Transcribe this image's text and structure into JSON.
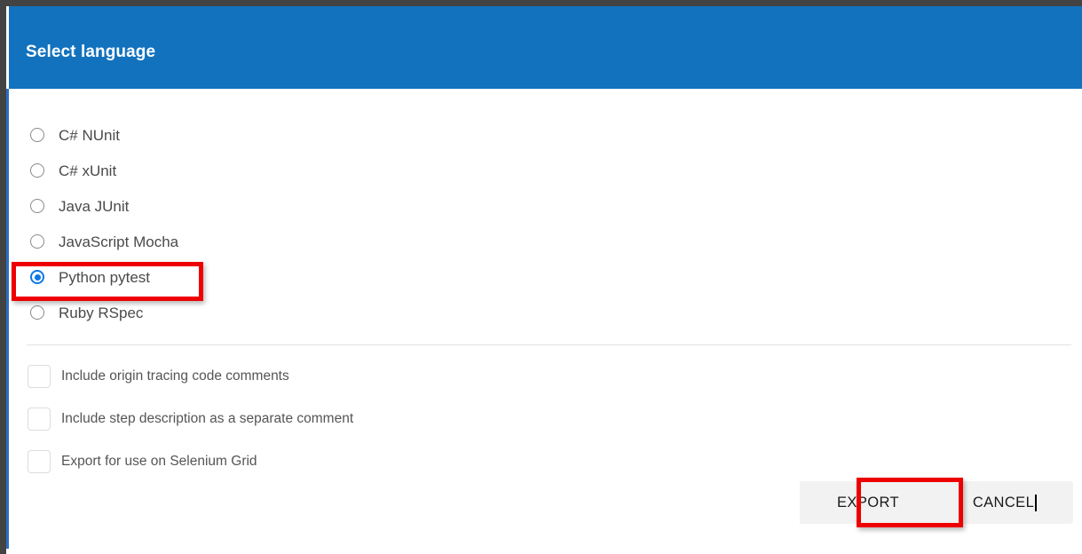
{
  "colors": {
    "header_blue": "#1272be",
    "chrome_dark": "#434343",
    "accent_blue": "#0b79e6",
    "annotation_red": "#ee0000",
    "button_bg": "#f2f2f2",
    "divider": "#e2e2e2",
    "scrollbar_blue": "#2a6fc4"
  },
  "dialog": {
    "title": "Select language"
  },
  "language_group": {
    "name": "language",
    "selected": "Python pytest",
    "options": [
      {
        "label": "C# NUnit",
        "selected": false
      },
      {
        "label": "C# xUnit",
        "selected": false
      },
      {
        "label": "Java JUnit",
        "selected": false
      },
      {
        "label": "JavaScript Mocha",
        "selected": false
      },
      {
        "label": "Python pytest",
        "selected": true
      },
      {
        "label": "Ruby RSpec",
        "selected": false
      }
    ]
  },
  "export_options": [
    {
      "label": "Include origin tracing code comments",
      "checked": false
    },
    {
      "label": "Include step description as a separate comment",
      "checked": false
    },
    {
      "label": "Export for use on Selenium Grid",
      "checked": false
    }
  ],
  "actions": {
    "export_label": "EXPORT",
    "cancel_label": "CANCEL"
  },
  "annotations": {
    "selected_option_box": "Python pytest",
    "primary_action_box": "EXPORT"
  }
}
